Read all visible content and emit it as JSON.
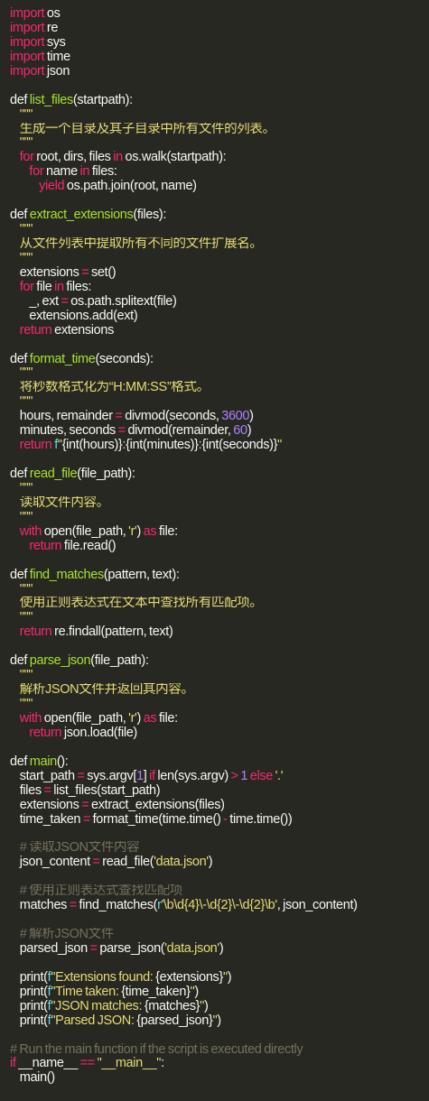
{
  "theme": {
    "background": "#272822",
    "default": "#f8f8f2",
    "colors": {
      "kw": "#f92672",
      "fn": "#a6e22e",
      "str": "#e6db74",
      "num": "#ae81ff",
      "cm": "#75715e",
      "bi": "#66d9ef",
      "tx": "#f8f8f2"
    }
  },
  "code_lines": [
    [
      [
        "kw",
        "import"
      ],
      [
        "tx",
        " os"
      ]
    ],
    [
      [
        "kw",
        "import"
      ],
      [
        "tx",
        " re"
      ]
    ],
    [
      [
        "kw",
        "import"
      ],
      [
        "tx",
        " sys"
      ]
    ],
    [
      [
        "kw",
        "import"
      ],
      [
        "tx",
        " time"
      ]
    ],
    [
      [
        "kw",
        "import"
      ],
      [
        "tx",
        " json"
      ]
    ],
    [],
    [
      [
        "tx",
        "def "
      ],
      [
        "fn",
        "list_files"
      ],
      [
        "tx",
        "(startpath):"
      ]
    ],
    [
      [
        "str",
        "    \"\"\""
      ]
    ],
    [
      [
        "str",
        "    生成一个目录及其子目录中所有文件的列表。"
      ]
    ],
    [
      [
        "str",
        "    \"\"\""
      ]
    ],
    [
      [
        "kw",
        "    for"
      ],
      [
        "tx",
        " root, dirs, files "
      ],
      [
        "kw",
        "in"
      ],
      [
        "tx",
        " os.walk(startpath):"
      ]
    ],
    [
      [
        "kw",
        "        for"
      ],
      [
        "tx",
        " name "
      ],
      [
        "kw",
        "in"
      ],
      [
        "tx",
        " files:"
      ]
    ],
    [
      [
        "kw",
        "            yield"
      ],
      [
        "tx",
        " os.path.join(root, name)"
      ]
    ],
    [],
    [
      [
        "tx",
        "def "
      ],
      [
        "fn",
        "extract_extensions"
      ],
      [
        "tx",
        "(files):"
      ]
    ],
    [
      [
        "str",
        "    \"\"\""
      ]
    ],
    [
      [
        "str",
        "    从文件列表中提取所有不同的文件扩展名。"
      ]
    ],
    [
      [
        "str",
        "    \"\"\""
      ]
    ],
    [
      [
        "tx",
        "    extensions "
      ],
      [
        "kw",
        "="
      ],
      [
        "tx",
        " set()"
      ]
    ],
    [
      [
        "kw",
        "    for"
      ],
      [
        "tx",
        " file "
      ],
      [
        "kw",
        "in"
      ],
      [
        "tx",
        " files:"
      ]
    ],
    [
      [
        "tx",
        "        _, ext "
      ],
      [
        "kw",
        "="
      ],
      [
        "tx",
        " os.path.splitext(file)"
      ]
    ],
    [
      [
        "tx",
        "        extensions.add(ext)"
      ]
    ],
    [
      [
        "kw",
        "    return"
      ],
      [
        "tx",
        " extensions"
      ]
    ],
    [],
    [
      [
        "tx",
        "def "
      ],
      [
        "fn",
        "format_time"
      ],
      [
        "tx",
        "(seconds):"
      ]
    ],
    [
      [
        "str",
        "    \"\"\""
      ]
    ],
    [
      [
        "str",
        "    将秒数格式化为“H:MM:SS”格式。"
      ]
    ],
    [
      [
        "str",
        "    \"\"\""
      ]
    ],
    [
      [
        "tx",
        "    hours, remainder "
      ],
      [
        "kw",
        "="
      ],
      [
        "tx",
        " divmod(seconds, "
      ],
      [
        "num",
        "3600"
      ],
      [
        "tx",
        ")"
      ]
    ],
    [
      [
        "tx",
        "    minutes, seconds "
      ],
      [
        "kw",
        "="
      ],
      [
        "tx",
        " divmod(remainder, "
      ],
      [
        "num",
        "60"
      ],
      [
        "tx",
        ")"
      ]
    ],
    [
      [
        "kw",
        "    return"
      ],
      [
        "tx",
        " "
      ],
      [
        "bi",
        "f"
      ],
      [
        "str",
        "\""
      ],
      [
        "tx",
        "{int(hours)}"
      ],
      [
        "str",
        ":"
      ],
      [
        "tx",
        "{int(minutes)}"
      ],
      [
        "str",
        ":"
      ],
      [
        "tx",
        "{int(seconds)}"
      ],
      [
        "str",
        "\""
      ]
    ],
    [],
    [
      [
        "tx",
        "def "
      ],
      [
        "fn",
        "read_file"
      ],
      [
        "tx",
        "(file_path):"
      ]
    ],
    [
      [
        "str",
        "    \"\"\""
      ]
    ],
    [
      [
        "str",
        "    读取文件内容。"
      ]
    ],
    [
      [
        "str",
        "    \"\"\""
      ]
    ],
    [
      [
        "kw",
        "    with"
      ],
      [
        "tx",
        " open(file_path, "
      ],
      [
        "str",
        "'r'"
      ],
      [
        "tx",
        ") "
      ],
      [
        "kw",
        "as"
      ],
      [
        "tx",
        " file:"
      ]
    ],
    [
      [
        "kw",
        "        return"
      ],
      [
        "tx",
        " file.read()"
      ]
    ],
    [],
    [
      [
        "tx",
        "def "
      ],
      [
        "fn",
        "find_matches"
      ],
      [
        "tx",
        "(pattern, text):"
      ]
    ],
    [
      [
        "str",
        "    \"\"\""
      ]
    ],
    [
      [
        "str",
        "    使用正则表达式在文本中查找所有匹配项。"
      ]
    ],
    [
      [
        "str",
        "    \"\"\""
      ]
    ],
    [
      [
        "kw",
        "    return"
      ],
      [
        "tx",
        " re.findall(pattern, text)"
      ]
    ],
    [],
    [
      [
        "tx",
        "def "
      ],
      [
        "fn",
        "parse_json"
      ],
      [
        "tx",
        "(file_path):"
      ]
    ],
    [
      [
        "str",
        "    \"\"\""
      ]
    ],
    [
      [
        "str",
        "    解析JSON文件并返回其内容。"
      ]
    ],
    [
      [
        "str",
        "    \"\"\""
      ]
    ],
    [
      [
        "kw",
        "    with"
      ],
      [
        "tx",
        " open(file_path, "
      ],
      [
        "str",
        "'r'"
      ],
      [
        "tx",
        ") "
      ],
      [
        "kw",
        "as"
      ],
      [
        "tx",
        " file:"
      ]
    ],
    [
      [
        "kw",
        "        return"
      ],
      [
        "tx",
        " json.load(file)"
      ]
    ],
    [],
    [
      [
        "tx",
        "def "
      ],
      [
        "fn",
        "main"
      ],
      [
        "tx",
        "():"
      ]
    ],
    [
      [
        "tx",
        "    start_path "
      ],
      [
        "kw",
        "="
      ],
      [
        "tx",
        " sys.argv["
      ],
      [
        "num",
        "1"
      ],
      [
        "tx",
        "] "
      ],
      [
        "kw",
        "if"
      ],
      [
        "tx",
        " len(sys.argv) "
      ],
      [
        "kw",
        ">"
      ],
      [
        "tx",
        " "
      ],
      [
        "num",
        "1"
      ],
      [
        "tx",
        " "
      ],
      [
        "kw",
        "else"
      ],
      [
        "tx",
        " "
      ],
      [
        "str",
        "'.'"
      ]
    ],
    [
      [
        "tx",
        "    files "
      ],
      [
        "kw",
        "="
      ],
      [
        "tx",
        " list_files(start_path)"
      ]
    ],
    [
      [
        "tx",
        "    extensions "
      ],
      [
        "kw",
        "="
      ],
      [
        "tx",
        " extract_extensions(files)"
      ]
    ],
    [
      [
        "tx",
        "    time_taken "
      ],
      [
        "kw",
        "="
      ],
      [
        "tx",
        " format_time(time.time() "
      ],
      [
        "kw",
        "-"
      ],
      [
        "tx",
        " time.time())"
      ]
    ],
    [],
    [
      [
        "cm",
        "    # 读取JSON文件内容"
      ]
    ],
    [
      [
        "tx",
        "    json_content "
      ],
      [
        "kw",
        "="
      ],
      [
        "tx",
        " read_file("
      ],
      [
        "str",
        "'data.json'"
      ],
      [
        "tx",
        ")"
      ]
    ],
    [],
    [
      [
        "cm",
        "    # 使用正则表达式查找匹配项"
      ]
    ],
    [
      [
        "tx",
        "    matches "
      ],
      [
        "kw",
        "="
      ],
      [
        "tx",
        " find_matches("
      ],
      [
        "bi",
        "r"
      ],
      [
        "str",
        "'\\b\\d{4}\\-\\d{2}\\-\\d{2}\\b'"
      ],
      [
        "tx",
        ", json_content)"
      ]
    ],
    [],
    [
      [
        "cm",
        "    # 解析JSON文件"
      ]
    ],
    [
      [
        "tx",
        "    parsed_json "
      ],
      [
        "kw",
        "="
      ],
      [
        "tx",
        " parse_json("
      ],
      [
        "str",
        "'data.json'"
      ],
      [
        "tx",
        ")"
      ]
    ],
    [],
    [
      [
        "tx",
        "    print("
      ],
      [
        "bi",
        "f"
      ],
      [
        "str",
        "\"Extensions found: "
      ],
      [
        "tx",
        "{extensions}"
      ],
      [
        "str",
        "\""
      ],
      [
        "tx",
        ")"
      ]
    ],
    [
      [
        "tx",
        "    print("
      ],
      [
        "bi",
        "f"
      ],
      [
        "str",
        "\"Time taken: "
      ],
      [
        "tx",
        "{time_taken}"
      ],
      [
        "str",
        "\""
      ],
      [
        "tx",
        ")"
      ]
    ],
    [
      [
        "tx",
        "    print("
      ],
      [
        "bi",
        "f"
      ],
      [
        "str",
        "\"JSON matches: "
      ],
      [
        "tx",
        "{matches}"
      ],
      [
        "str",
        "\""
      ],
      [
        "tx",
        ")"
      ]
    ],
    [
      [
        "tx",
        "    print("
      ],
      [
        "bi",
        "f"
      ],
      [
        "str",
        "\"Parsed JSON: "
      ],
      [
        "tx",
        "{parsed_json}"
      ],
      [
        "str",
        "\""
      ],
      [
        "tx",
        ")"
      ]
    ],
    [],
    [
      [
        "cm",
        "# Run the main function if the script is executed directly"
      ]
    ],
    [
      [
        "kw",
        "if"
      ],
      [
        "tx",
        " __name__ "
      ],
      [
        "kw",
        "=="
      ],
      [
        "tx",
        " "
      ],
      [
        "str",
        "\"__main__\""
      ],
      [
        "tx",
        ":"
      ]
    ],
    [
      [
        "tx",
        "    main()"
      ]
    ]
  ]
}
